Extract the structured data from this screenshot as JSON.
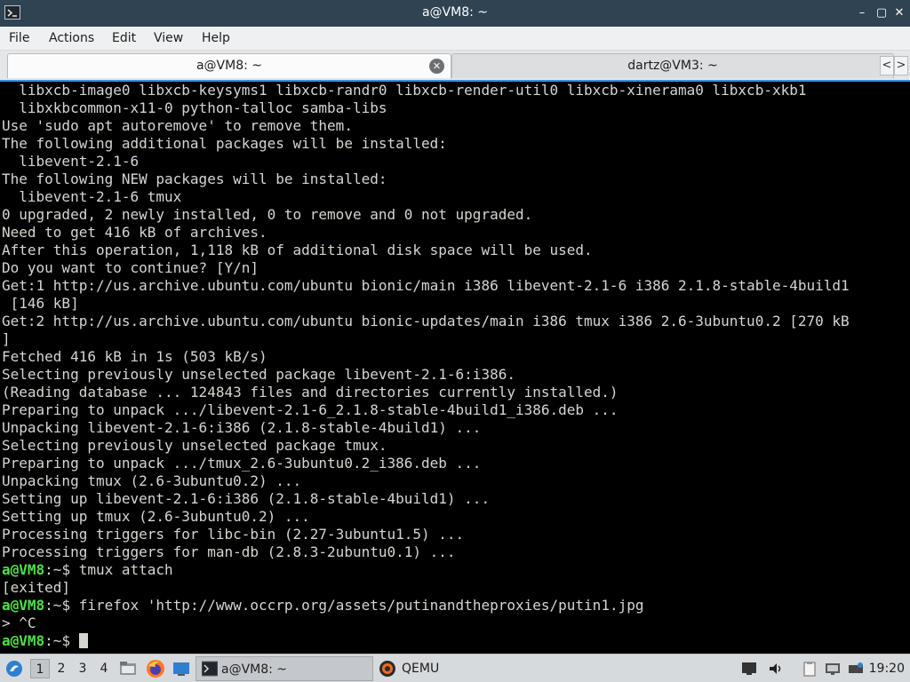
{
  "window": {
    "title": "a@VM8: ~",
    "buttons": {
      "minimize": "–",
      "maximize": "▢",
      "close": "✕"
    }
  },
  "menu": [
    "File",
    "Actions",
    "Edit",
    "View",
    "Help"
  ],
  "tabs": [
    {
      "label": "a@VM8: ~",
      "active": true
    },
    {
      "label": "dartz@VM3: ~",
      "active": false
    }
  ],
  "tab_scroll": {
    "left": "<",
    "right": ">"
  },
  "terminal": {
    "lines": [
      {
        "text": "  libxcb-image0 libxcb-keysyms1 libxcb-randr0 libxcb-render-util0 libxcb-xinerama0 libxcb-xkb1"
      },
      {
        "text": "  libxkbcommon-x11-0 python-talloc samba-libs"
      },
      {
        "text": "Use 'sudo apt autoremove' to remove them."
      },
      {
        "text": "The following additional packages will be installed:"
      },
      {
        "text": "  libevent-2.1-6"
      },
      {
        "text": "The following NEW packages will be installed:"
      },
      {
        "text": "  libevent-2.1-6 tmux"
      },
      {
        "text": "0 upgraded, 2 newly installed, 0 to remove and 0 not upgraded."
      },
      {
        "text": "Need to get 416 kB of archives."
      },
      {
        "text": "After this operation, 1,118 kB of additional disk space will be used."
      },
      {
        "text": "Do you want to continue? [Y/n]"
      },
      {
        "text": "Get:1 http://us.archive.ubuntu.com/ubuntu bionic/main i386 libevent-2.1-6 i386 2.1.8-stable-4build1"
      },
      {
        "text": " [146 kB]"
      },
      {
        "text": "Get:2 http://us.archive.ubuntu.com/ubuntu bionic-updates/main i386 tmux i386 2.6-3ubuntu0.2 [270 kB"
      },
      {
        "text": "]"
      },
      {
        "text": "Fetched 416 kB in 1s (503 kB/s)"
      },
      {
        "text": "Selecting previously unselected package libevent-2.1-6:i386."
      },
      {
        "text": "(Reading database ... 124843 files and directories currently installed.)"
      },
      {
        "text": "Preparing to unpack .../libevent-2.1-6_2.1.8-stable-4build1_i386.deb ..."
      },
      {
        "text": "Unpacking libevent-2.1-6:i386 (2.1.8-stable-4build1) ..."
      },
      {
        "text": "Selecting previously unselected package tmux."
      },
      {
        "text": "Preparing to unpack .../tmux_2.6-3ubuntu0.2_i386.deb ..."
      },
      {
        "text": "Unpacking tmux (2.6-3ubuntu0.2) ..."
      },
      {
        "text": "Setting up libevent-2.1-6:i386 (2.1.8-stable-4build1) ..."
      },
      {
        "text": "Setting up tmux (2.6-3ubuntu0.2) ..."
      },
      {
        "text": "Processing triggers for libc-bin (2.27-3ubuntu1.5) ..."
      },
      {
        "text": "Processing triggers for man-db (2.8.3-2ubuntu0.1) ..."
      },
      {
        "prompt": "a@VM8",
        "path": ":~$",
        "text": " tmux attach"
      },
      {
        "text": "[exited]"
      },
      {
        "prompt": "a@VM8",
        "path": ":~$",
        "text": " firefox 'http://www.occrp.org/assets/putinandtheproxies/putin1.jpg"
      },
      {
        "text": "> ^C"
      },
      {
        "prompt": "a@VM8",
        "path": ":~$",
        "text": " ",
        "cursor": true
      }
    ]
  },
  "taskbar": {
    "start_icon": "lxqt-start-icon",
    "workspaces": [
      "1",
      "2",
      "3",
      "4"
    ],
    "current_workspace": "1",
    "quicklaunch": [
      "file-manager-icon",
      "firefox-icon",
      "desktop-icon"
    ],
    "tasks": [
      {
        "label": "a@VM8: ~",
        "icon": "terminal-icon",
        "active": true
      },
      {
        "label": "QEMU",
        "icon": "qemu-icon",
        "active": false
      }
    ],
    "tray": [
      "screen-icon",
      "volume-icon",
      "clipboard-icon",
      "network-icon",
      "keyboard-icon"
    ],
    "clock": "19:20"
  }
}
